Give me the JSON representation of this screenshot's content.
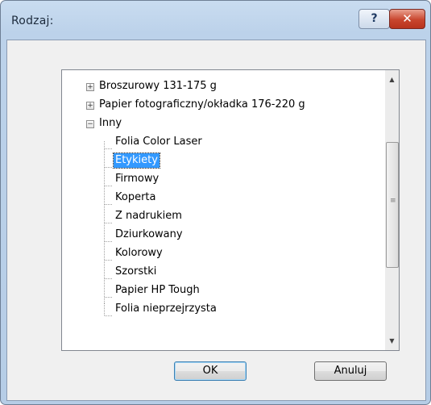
{
  "window": {
    "title": "Rodzaj:",
    "help_glyph": "?",
    "close_glyph": "✕"
  },
  "tree": {
    "items": [
      {
        "label": "Broszurowy 131-175 g",
        "expander": "+",
        "level": 0
      },
      {
        "label": "Papier fotograficzny/okładka 176-220 g",
        "expander": "+",
        "level": 0
      },
      {
        "label": "Inny",
        "expander": "−",
        "level": 0
      },
      {
        "label": "Folia Color Laser",
        "level": 1
      },
      {
        "label": "Etykiety",
        "level": 1,
        "selected": true
      },
      {
        "label": "Firmowy",
        "level": 1
      },
      {
        "label": "Koperta",
        "level": 1
      },
      {
        "label": "Z nadrukiem",
        "level": 1
      },
      {
        "label": "Dziurkowany",
        "level": 1
      },
      {
        "label": "Kolorowy",
        "level": 1
      },
      {
        "label": "Szorstki",
        "level": 1
      },
      {
        "label": "Papier HP Tough",
        "level": 1
      },
      {
        "label": "Folia nieprzejrzysta",
        "level": 1
      }
    ],
    "scroll_up_glyph": "▲",
    "scroll_down_glyph": "▼"
  },
  "buttons": {
    "ok_label": "OK",
    "cancel_label": "Anuluj"
  },
  "colors": {
    "selection": "#3399ff",
    "close_button": "#c8452d"
  }
}
